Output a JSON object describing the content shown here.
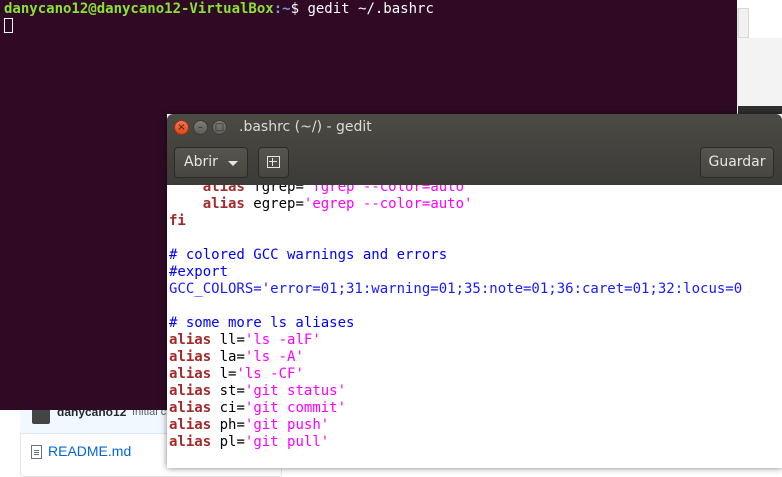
{
  "terminal": {
    "user_host": "danycano12@danycano12-VirtualBox",
    "path": ":~",
    "prompt_symbol": "$ ",
    "command": "gedit ~/.bashrc"
  },
  "background_page": {
    "commit_user": "danycano12",
    "commit_message": "Initial c",
    "file_name": "README.md"
  },
  "gedit": {
    "title": ".bashrc (~/) - gedit",
    "open_label": "Abrir",
    "save_label": "Guardar",
    "close_glyph": "×",
    "minimize_glyph": "–",
    "maximize_glyph": "□",
    "icons": [
      "close-icon",
      "minimize-icon",
      "maximize-icon",
      "caret-down-icon",
      "new-document-icon"
    ]
  },
  "code": [
    {
      "indent": "    ",
      "kw": "alias",
      "name": " fgrep",
      "eq": "=",
      "val": "'fgrep --color=auto'"
    },
    {
      "indent": "    ",
      "kw": "alias",
      "name": " egrep",
      "eq": "=",
      "val": "'egrep --color=auto'"
    },
    {
      "plain": "fi"
    },
    {
      "blank": ""
    },
    {
      "comment": "# colored GCC warnings and errors"
    },
    {
      "comment": "#export"
    },
    {
      "blueline": "GCC_COLORS='error=01;31:warning=01;35:note=01;36:caret=01;32:locus=0"
    },
    {
      "blank": ""
    },
    {
      "comment": "# some more ls aliases"
    },
    {
      "kw": "alias",
      "name": " ll",
      "eq": "=",
      "val": "'ls -alF'"
    },
    {
      "kw": "alias",
      "name": " la",
      "eq": "=",
      "val": "'ls -A'"
    },
    {
      "kw": "alias",
      "name": " l",
      "eq": "=",
      "val": "'ls -CF'"
    },
    {
      "kw": "alias",
      "name": " st",
      "eq": "=",
      "val": "'git status'"
    },
    {
      "kw": "alias",
      "name": " ci",
      "eq": "=",
      "val": "'git commit'"
    },
    {
      "kw": "alias",
      "name": " ph",
      "eq": "=",
      "val": "'git push'"
    },
    {
      "kw": "alias",
      "name": " pl",
      "eq": "=",
      "val": "'git pull'"
    }
  ]
}
